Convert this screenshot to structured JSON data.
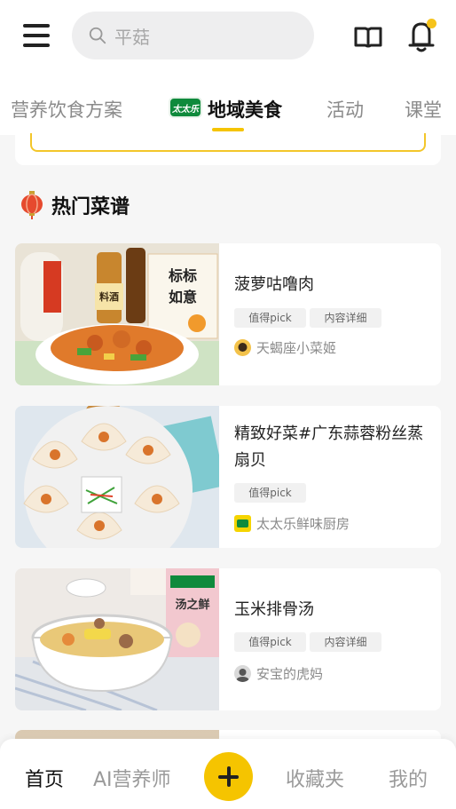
{
  "search": {
    "placeholder": "平菇"
  },
  "tabs": [
    {
      "label": "营养饮食方案",
      "active": false
    },
    {
      "label": "地域美食",
      "active": true,
      "brand_logo_text": "太太乐"
    },
    {
      "label": "活动",
      "active": false
    },
    {
      "label": "课堂",
      "active": false
    }
  ],
  "section": {
    "title": "热门菜谱"
  },
  "recipes": [
    {
      "title": "菠萝咕噜肉",
      "tags": [
        "值得pick",
        "内容详细"
      ],
      "author": "天蝎座小菜姬",
      "image_text": [
        "料酒",
        "标标",
        "如意"
      ]
    },
    {
      "title": "精致好菜#广东蒜蓉粉丝蒸扇贝",
      "tags": [
        "值得pick"
      ],
      "author": "太太乐鲜味厨房"
    },
    {
      "title": "玉米排骨汤",
      "tags": [
        "值得pick",
        "内容详细"
      ],
      "author": "安宝的虎妈",
      "image_text": [
        "汤之鲜"
      ]
    }
  ],
  "bottom_nav": {
    "home": "首页",
    "ai": "AI营养师",
    "favorites": "收藏夹",
    "mine": "我的"
  },
  "colors": {
    "accent": "#f5c400",
    "brand_green": "#0f8a3c"
  }
}
